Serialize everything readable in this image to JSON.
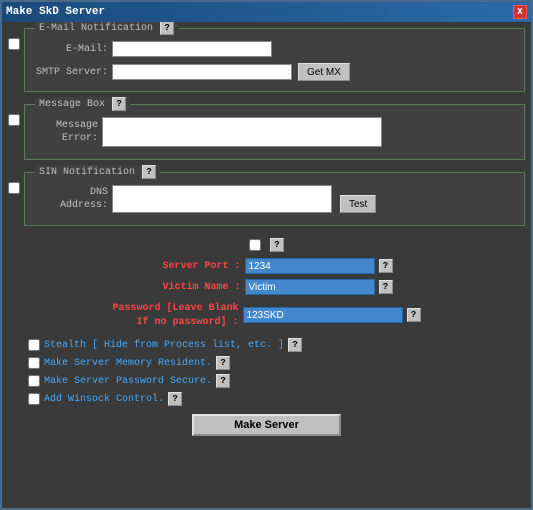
{
  "window": {
    "title": "Make SkD Server",
    "close_label": "X"
  },
  "email_section": {
    "legend": "E-Mail Notification",
    "help": "?",
    "email_label": "E-Mail:",
    "smtp_label": "SMTP Server:",
    "get_mx_btn": "Get MX",
    "email_value": "",
    "smtp_value": ""
  },
  "message_section": {
    "legend": "Message Box",
    "help": "?",
    "message_label": "Message",
    "error_label": "Error:",
    "message_value": ""
  },
  "sin_section": {
    "legend": "SIN Notification",
    "help": "?",
    "dns_label": "DNS",
    "address_label": "Address:",
    "test_btn": "Test",
    "dns_value": ""
  },
  "server_port": {
    "label": "Server Port :",
    "value": "1234",
    "help": "?"
  },
  "victim_name": {
    "label": "Victim Name :",
    "value": "Victim",
    "help": "?"
  },
  "password": {
    "label": "Password [Leave Blank\nIf no password] :",
    "value": "123SKD",
    "help": "?"
  },
  "options": [
    {
      "id": "stealth",
      "label": "Stealth [ Hide from Process list, etc. ]",
      "help": "?"
    },
    {
      "id": "memory",
      "label": "Make Server Memory Resident.",
      "help": "?"
    },
    {
      "id": "password_secure",
      "label": "Make Server Password Secure.",
      "help": "?"
    },
    {
      "id": "winsock",
      "label": "Add Winsock Control.",
      "help": "?"
    }
  ],
  "make_server_btn": "Make Server"
}
